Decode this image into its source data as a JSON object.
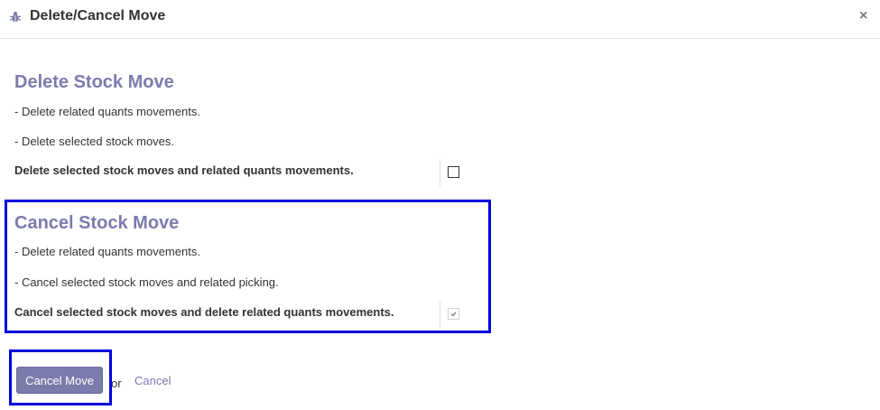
{
  "dialog": {
    "title": "Delete/Cancel Move",
    "close_glyph": "×"
  },
  "delete_section": {
    "title": "Delete Stock Move",
    "lines": [
      "- Delete related quants movements.",
      "- Delete selected stock moves."
    ],
    "option_label": "Delete selected stock moves and related quants movements.",
    "option_checked": false
  },
  "cancel_section": {
    "title": "Cancel Stock Move",
    "lines": [
      "- Delete related quants movements.",
      "- Cancel selected stock moves and related picking."
    ],
    "option_label": "Cancel selected stock moves and delete related quants movements.",
    "option_checked": true
  },
  "footer": {
    "primary_label": "Cancel Move",
    "or_label": "or",
    "cancel_label": "Cancel"
  },
  "colors": {
    "accent": "#7c7bad",
    "highlight": "#0000e0"
  }
}
